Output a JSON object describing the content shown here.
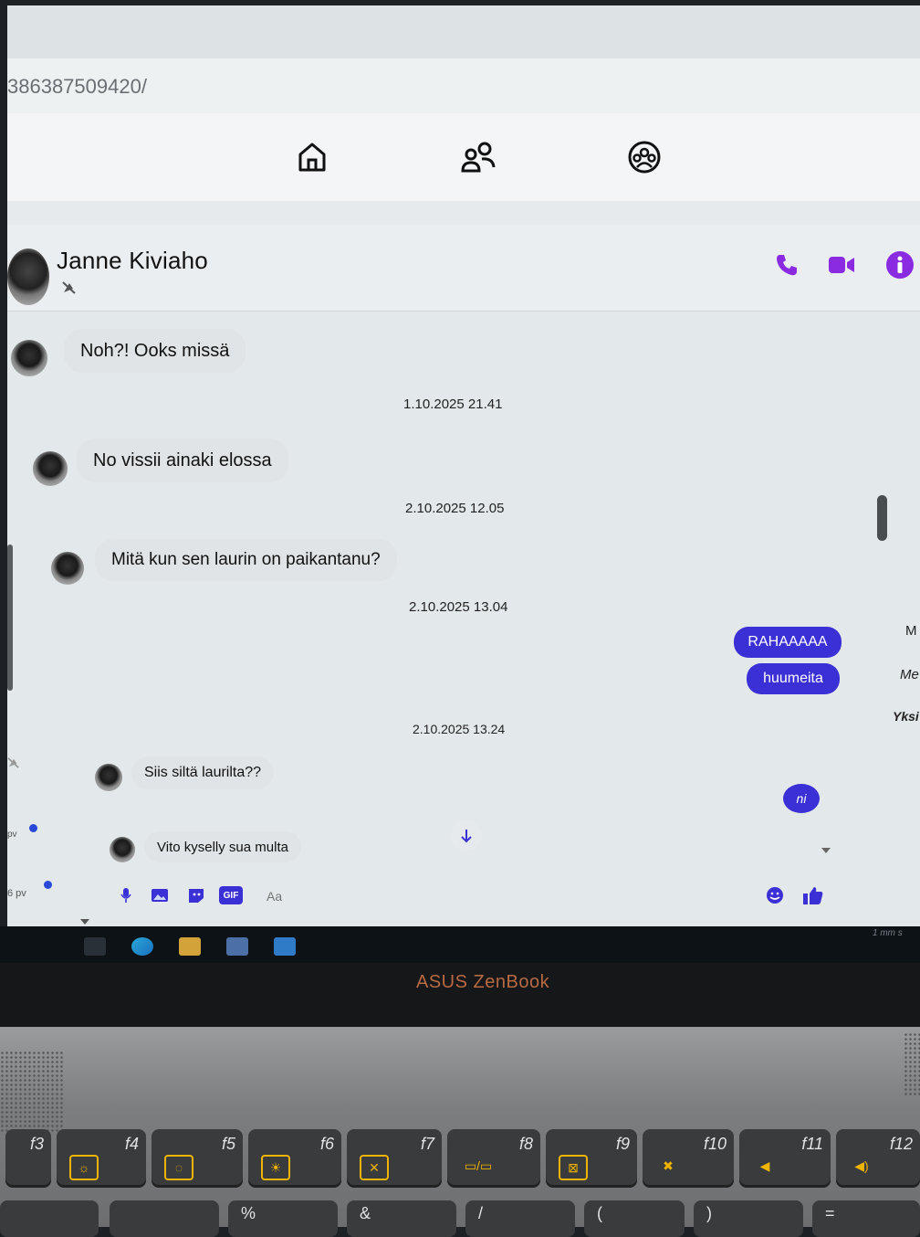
{
  "browser": {
    "url": "386387509420/"
  },
  "nav": {
    "icons": [
      "home-icon",
      "people-icon",
      "groups-icon"
    ]
  },
  "chat": {
    "contact_name": "Janne Kiviaho",
    "header_icons": [
      "phone-icon",
      "video-icon",
      "info-icon"
    ],
    "accent_color": "#3b2fd6",
    "messages": [
      {
        "type": "in",
        "text": "Noh?! Ooks missä"
      },
      {
        "type": "time",
        "text": "1.10.2025 21.41"
      },
      {
        "type": "in",
        "text": "No vissii ainaki elossa"
      },
      {
        "type": "time",
        "text": "2.10.2025 12.05"
      },
      {
        "type": "in",
        "text": "Mitä kun sen laurin on paikantanu?"
      },
      {
        "type": "time",
        "text": "2.10.2025 13.04"
      },
      {
        "type": "out",
        "text": "RAHAAAAA"
      },
      {
        "type": "out",
        "text": "huumeita"
      },
      {
        "type": "time",
        "text": "2.10.2025 13.24"
      },
      {
        "type": "in",
        "text": "Siis siltä laurilta??"
      },
      {
        "type": "out",
        "text": "ni"
      },
      {
        "type": "in",
        "text": "Vito kyselly sua multa"
      }
    ]
  },
  "sidebar_right": {
    "fragments": [
      "M",
      "Me",
      "Yksi"
    ]
  },
  "sidebar_left": {
    "times": [
      "pv",
      "6 pv"
    ]
  },
  "composer": {
    "placeholder": "Aa",
    "gif_label": "GIF"
  },
  "taskbar": {
    "clock_fragment": "1 mm s"
  },
  "laptop": {
    "brand": "ASUS ZenBook",
    "fkeys": [
      "f3",
      "f4",
      "f5",
      "f6",
      "f7",
      "f8",
      "f9",
      "f10",
      "f11",
      "f12"
    ],
    "row2": [
      "",
      "",
      "%",
      "&",
      "/",
      "(",
      ")",
      "="
    ]
  }
}
